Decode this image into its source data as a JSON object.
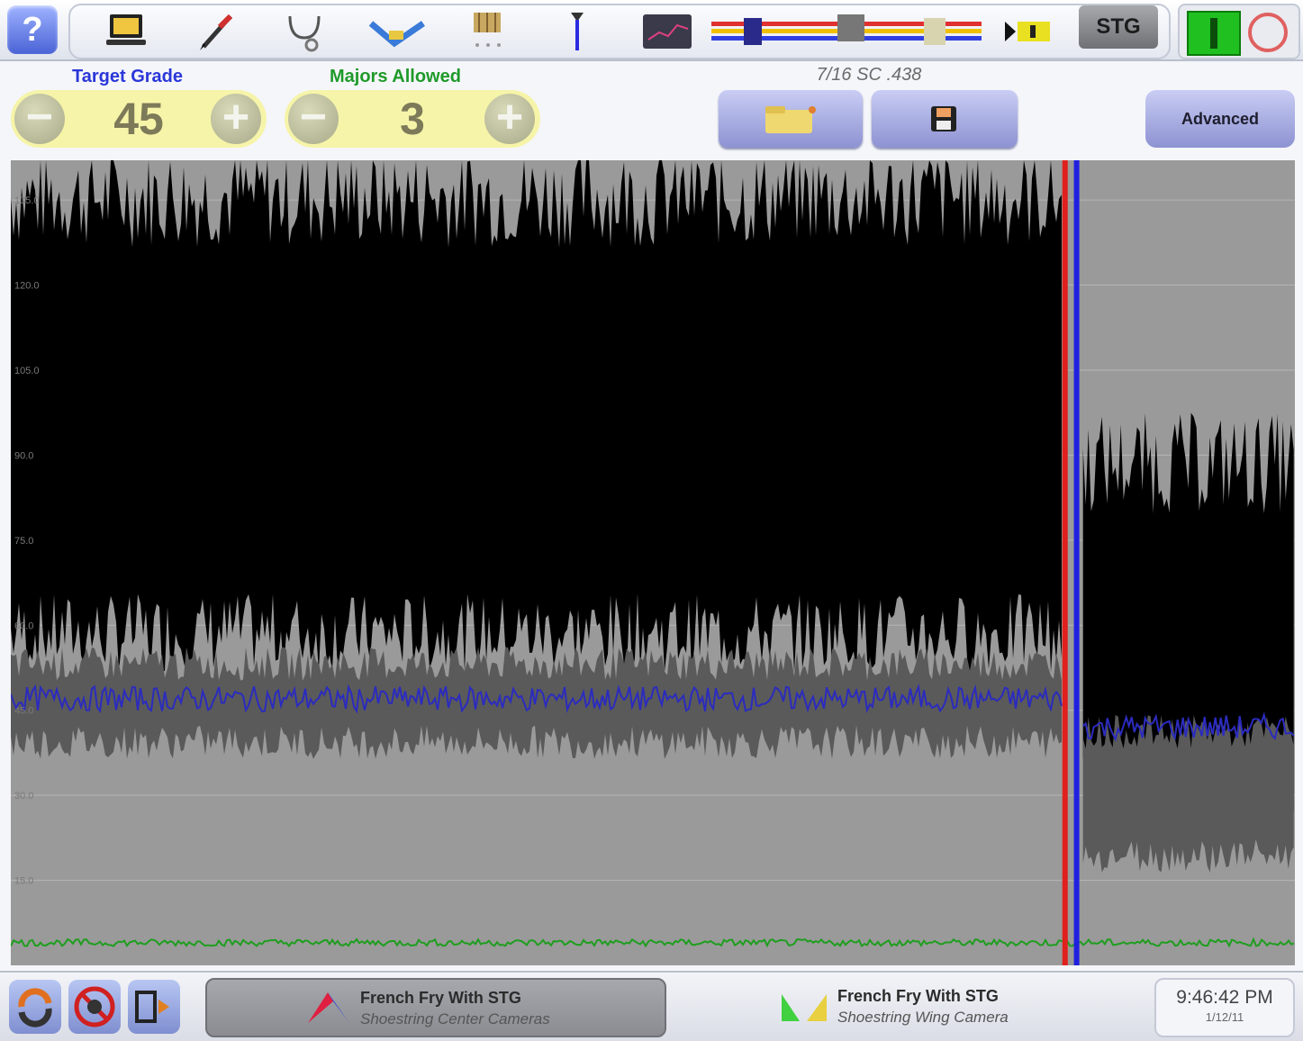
{
  "toolbar": {
    "help_label": "?",
    "stg_label": "STG",
    "tools": [
      {
        "name": "monitor-icon"
      },
      {
        "name": "pen-icon"
      },
      {
        "name": "stethoscope-icon"
      },
      {
        "name": "conveyor-icon"
      },
      {
        "name": "sorter-icon"
      },
      {
        "name": "probe-icon"
      },
      {
        "name": "trend-chart-icon"
      },
      {
        "name": "color-stripes-icon"
      },
      {
        "name": "camera-stripes-icon"
      },
      {
        "name": "yellow-tag-icon"
      }
    ],
    "status_green": "#20c020",
    "status_red": "#e06060"
  },
  "controls": {
    "target_grade_label": "Target Grade",
    "target_grade_value": "45",
    "majors_allowed_label": "Majors Allowed",
    "majors_allowed_value": "3",
    "minus": "−",
    "plus": "+",
    "product_code": "7/16 SC .438",
    "advanced_label": "Advanced",
    "label_blue": "#2a36d8",
    "label_green": "#1f9a2a"
  },
  "chart_data": {
    "type": "area",
    "ylabel": "",
    "xlabel": "",
    "yticks": [
      "135.0",
      "120.0",
      "105.0",
      "90.0",
      "75.0",
      "60.0",
      "45.0",
      "30.0",
      "15.0"
    ],
    "ylim": [
      0,
      142
    ],
    "grid": true,
    "series": [
      {
        "role": "upper-band",
        "color": "#000000",
        "segments": [
          {
            "x": [
              0,
              0.82
            ],
            "low": 60,
            "high": 132
          },
          {
            "x": [
              0.835,
              1.0
            ],
            "low": 32,
            "high": 85
          }
        ]
      },
      {
        "role": "lower-band",
        "color": "#5a5a5a",
        "segments": [
          {
            "x": [
              0,
              0.82
            ],
            "low": 40,
            "high": 52
          },
          {
            "x": [
              0.835,
              1.0
            ],
            "low": 20,
            "high": 40
          }
        ]
      },
      {
        "role": "grade-line",
        "color": "#2b2bbf",
        "segments": [
          {
            "x": [
              0,
              0.82
            ],
            "y": 47
          },
          {
            "x": [
              0.835,
              1.0
            ],
            "y": 42
          }
        ]
      },
      {
        "role": "defect-line",
        "color": "#1e9e1e",
        "segments": [
          {
            "x": [
              0,
              1.0
            ],
            "y": 4
          }
        ]
      }
    ],
    "markers": [
      {
        "x": 0.821,
        "color": "#e0201c"
      },
      {
        "x": 0.83,
        "color": "#2020e0"
      }
    ]
  },
  "bottombar": {
    "icons": [
      {
        "name": "refresh-icon"
      },
      {
        "name": "no-camera-icon"
      },
      {
        "name": "exit-icon"
      }
    ],
    "product_a_title": "French Fry With STG",
    "product_a_sub": "Shoestring Center Cameras",
    "product_b_title": "French Fry With STG",
    "product_b_sub": "Shoestring Wing Camera",
    "time": "9:46:42 PM",
    "date": "1/12/11"
  }
}
